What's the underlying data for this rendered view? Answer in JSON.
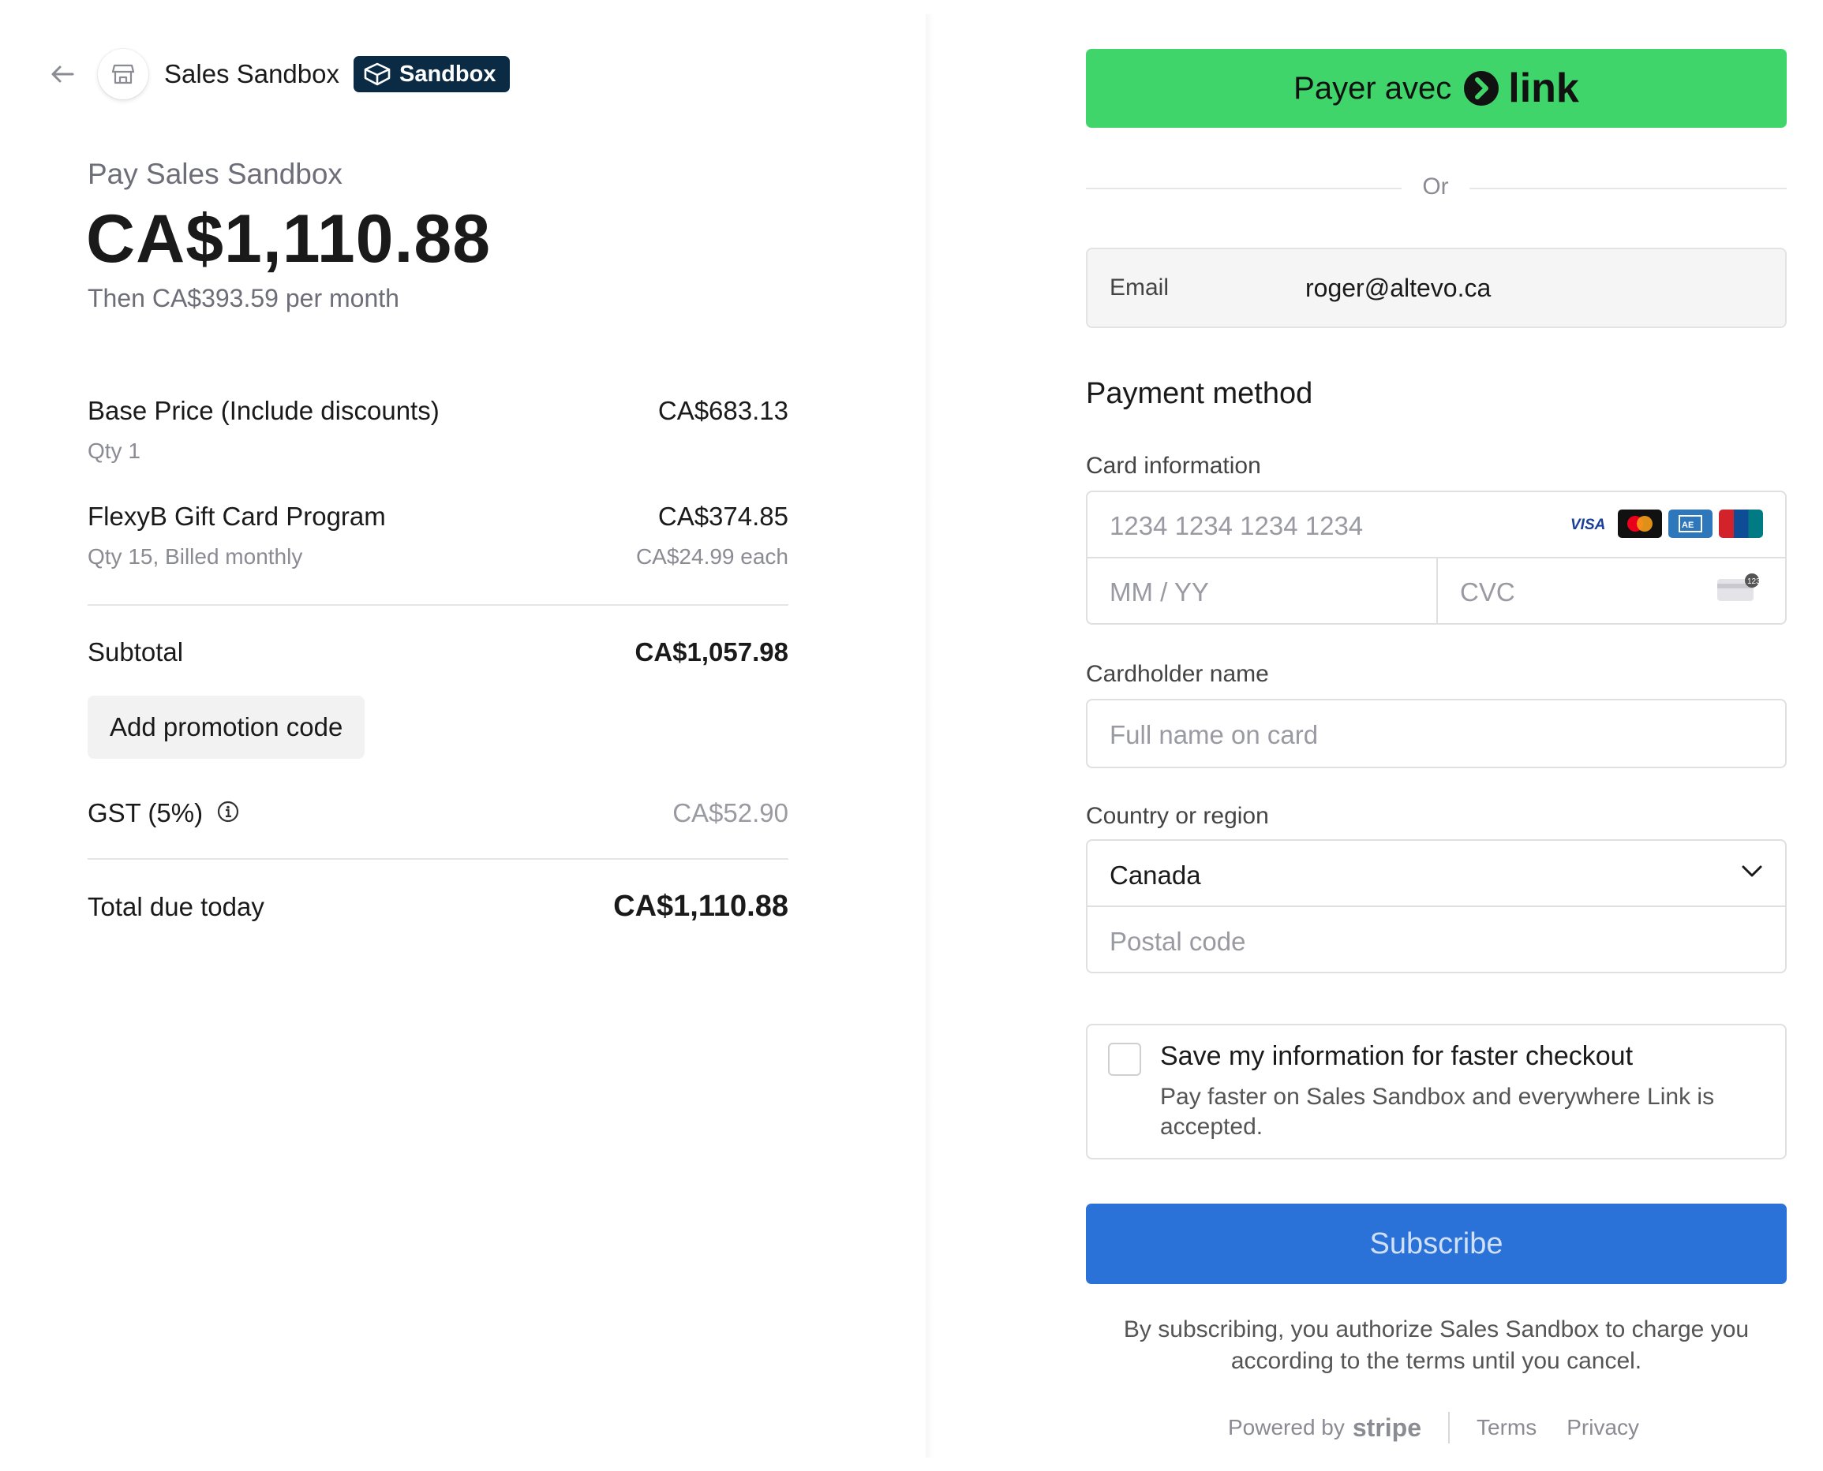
{
  "header": {
    "merchant_name": "Sales Sandbox",
    "badge_label": "Sandbox"
  },
  "summary": {
    "pay_to": "Pay Sales Sandbox",
    "amount": "CA$1,110.88",
    "recurring": "Then CA$393.59 per month"
  },
  "line_items": [
    {
      "name": "Base Price (Include discounts)",
      "price": "CA$683.13",
      "detail": "Qty 1",
      "unit": ""
    },
    {
      "name": "FlexyB Gift Card Program",
      "price": "CA$374.85",
      "detail": "Qty 15, Billed monthly",
      "unit": "CA$24.99 each"
    }
  ],
  "totals": {
    "subtotal_label": "Subtotal",
    "subtotal_value": "CA$1,057.98",
    "promo_label": "Add promotion code",
    "tax_label": "GST (5%)",
    "tax_value": "CA$52.90",
    "total_label": "Total due today",
    "total_value": "CA$1,110.88"
  },
  "link_button": {
    "prefix": "Payer avec",
    "brand": "link"
  },
  "divider_text": "Or",
  "email": {
    "label": "Email",
    "value": "roger@altevo.ca"
  },
  "payment": {
    "heading": "Payment method",
    "card_label": "Card information",
    "card_number_placeholder": "1234 1234 1234 1234",
    "expiry_placeholder": "MM / YY",
    "cvc_placeholder": "CVC",
    "brand_icons": [
      "visa-icon",
      "mastercard-icon",
      "amex-icon",
      "unionpay-icon"
    ],
    "cardholder_label": "Cardholder name",
    "cardholder_placeholder": "Full name on card",
    "country_label": "Country or region",
    "country_value": "Canada",
    "postal_placeholder": "Postal code"
  },
  "save_info": {
    "title": "Save my information for faster checkout",
    "description": "Pay faster on Sales Sandbox and everywhere Link is accepted."
  },
  "subscribe_label": "Subscribe",
  "legal_text": "By subscribing, you authorize Sales Sandbox to charge you according to the terms until you cancel.",
  "footer": {
    "powered_by": "Powered by",
    "stripe": "stripe",
    "terms": "Terms",
    "privacy": "Privacy"
  },
  "colors": {
    "link_green": "#3fd56b",
    "subscribe_blue": "#2a72d8",
    "badge_navy": "#0b2b45"
  }
}
